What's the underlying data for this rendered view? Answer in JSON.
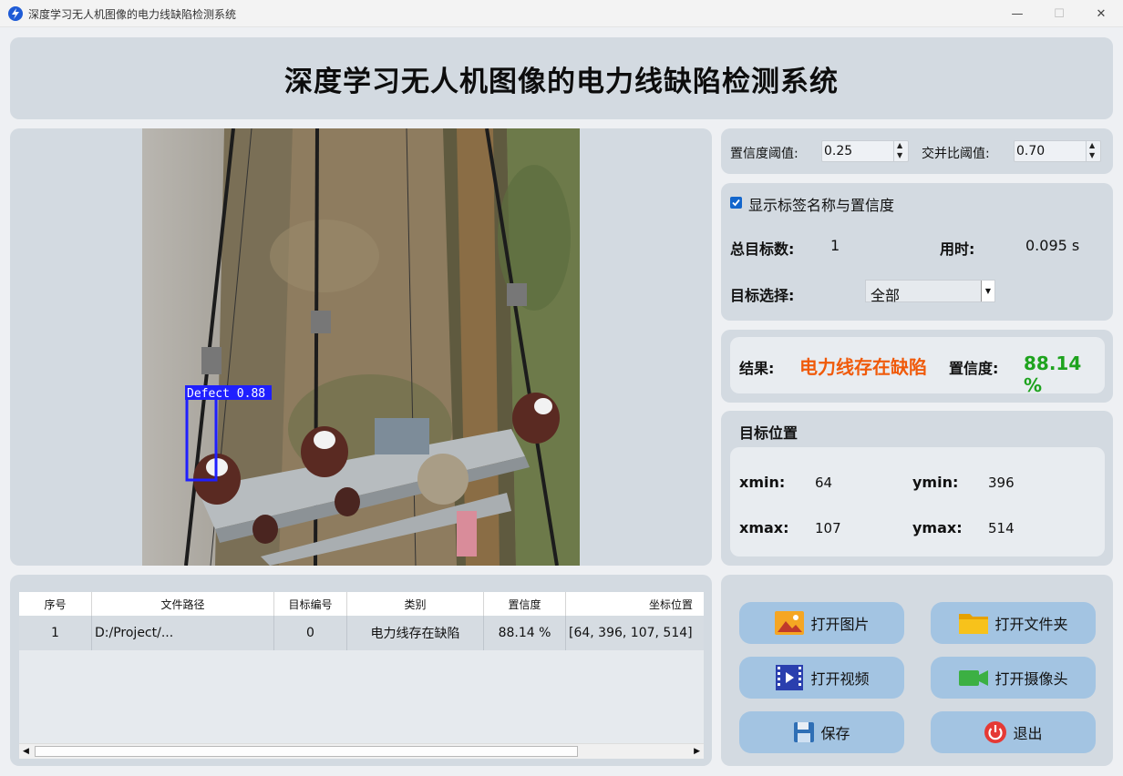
{
  "window": {
    "title": "深度学习无人机图像的电力线缺陷检测系统",
    "min": "—",
    "max": "☐",
    "close": "✕"
  },
  "header": {
    "title": "深度学习无人机图像的电力线缺陷检测系统"
  },
  "image": {
    "detection_label": "Defect  0.88"
  },
  "thresholds": {
    "conf_label": "置信度阈值:",
    "conf_value": "0.25",
    "iou_label": "交并比阈值:",
    "iou_value": "0.70"
  },
  "options": {
    "show_labels": "显示标签名称与置信度",
    "total_label": "总目标数:",
    "total_value": "1",
    "time_label": "用时:",
    "time_value": "0.095 s",
    "target_label": "目标选择:",
    "target_value": "全部"
  },
  "result": {
    "label": "结果:",
    "value": "电力线存在缺陷",
    "conf_label": "置信度:",
    "conf_value": "88.14 %",
    "value_color": "#f05a0a",
    "conf_color": "#1ea31e"
  },
  "position": {
    "title": "目标位置",
    "xmin_label": "xmin:",
    "xmin": "64",
    "ymin_label": "ymin:",
    "ymin": "396",
    "xmax_label": "xmax:",
    "xmax": "107",
    "ymax_label": "ymax:",
    "ymax": "514"
  },
  "table": {
    "headers": [
      "序号",
      "文件路径",
      "目标编号",
      "类别",
      "置信度",
      "坐标位置"
    ],
    "rows": [
      [
        "1",
        "D:/Project/...",
        "0",
        "电力线存在缺陷",
        "88.14 %",
        "[64, 396, 107, 514]"
      ]
    ]
  },
  "buttons": {
    "open_image": "打开图片",
    "open_folder": "打开文件夹",
    "open_video": "打开视频",
    "open_camera": "打开摄像头",
    "save": "保存",
    "exit": "退出"
  },
  "icons": {
    "app": "lightning-icon",
    "image": "picture-icon",
    "folder": "folder-icon",
    "video": "film-icon",
    "camera": "camera-icon",
    "save": "floppy-icon",
    "exit": "power-icon"
  }
}
